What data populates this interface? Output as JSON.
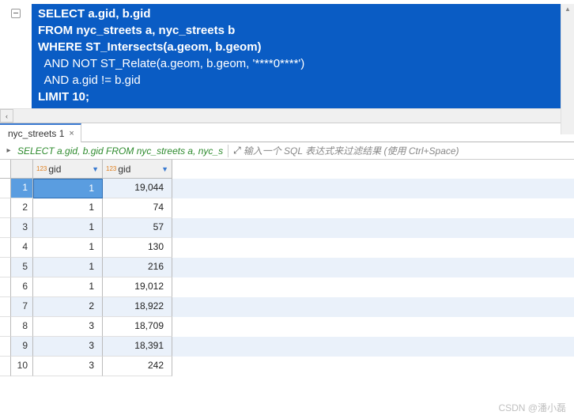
{
  "sql": {
    "line1": "SELECT a.gid, b.gid",
    "line2": "FROM nyc_streets a, nyc_streets b",
    "line3": "WHERE ST_Intersects(a.geom, b.geom)",
    "line4": "  AND NOT ST_Relate(a.geom, b.geom, '****0****')",
    "line5": "  AND a.gid != b.gid",
    "line6": "LIMIT 10;"
  },
  "tab": {
    "label": "nyc_streets 1",
    "close": "×"
  },
  "query_summary": "SELECT a.gid, b.gid FROM nyc_streets a, nyc_s",
  "filter_placeholder": "输入一个 SQL 表达式来过滤结果 (使用 Ctrl+Space)",
  "columns": [
    {
      "name": "gid",
      "type_prefix": "123",
      "sort_glyph": "▼"
    },
    {
      "name": "gid",
      "type_prefix": "123",
      "sort_glyph": "▼"
    }
  ],
  "chart_data": {
    "type": "table",
    "columns": [
      "gid",
      "gid"
    ],
    "rows": [
      [
        1,
        19044
      ],
      [
        1,
        74
      ],
      [
        1,
        57
      ],
      [
        1,
        130
      ],
      [
        1,
        216
      ],
      [
        1,
        19012
      ],
      [
        2,
        18922
      ],
      [
        3,
        18709
      ],
      [
        3,
        18391
      ],
      [
        3,
        242
      ]
    ]
  },
  "rows": [
    {
      "n": "1",
      "c1": "1",
      "c2": "19,044"
    },
    {
      "n": "2",
      "c1": "1",
      "c2": "74"
    },
    {
      "n": "3",
      "c1": "1",
      "c2": "57"
    },
    {
      "n": "4",
      "c1": "1",
      "c2": "130"
    },
    {
      "n": "5",
      "c1": "1",
      "c2": "216"
    },
    {
      "n": "6",
      "c1": "1",
      "c2": "19,012"
    },
    {
      "n": "7",
      "c1": "2",
      "c2": "18,922"
    },
    {
      "n": "8",
      "c1": "3",
      "c2": "18,709"
    },
    {
      "n": "9",
      "c1": "3",
      "c2": "18,391"
    },
    {
      "n": "10",
      "c1": "3",
      "c2": "242"
    }
  ],
  "watermark": "CSDN @潘小磊"
}
